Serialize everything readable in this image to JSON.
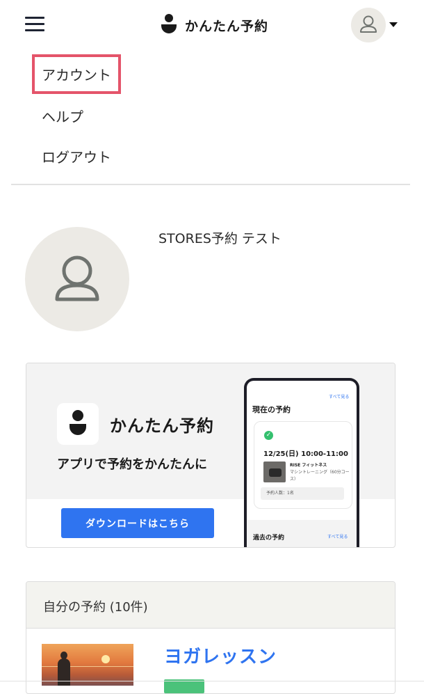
{
  "header": {
    "logo_text": "かんたん予約",
    "menu_icon": "hamburger-menu-icon",
    "user_icon": "user-icon",
    "caret_icon": "caret-down-icon"
  },
  "menu": {
    "items": [
      {
        "label": "アカウント"
      },
      {
        "label": "ヘルプ"
      },
      {
        "label": "ログアウト"
      }
    ],
    "highlight_color": "#e4546a"
  },
  "profile": {
    "name": "STORES予約 テスト"
  },
  "banner": {
    "app_name": "かんたん予約",
    "tagline": "アプリで予約をかんたんに",
    "download_label": "ダウンロードはこちら",
    "phone": {
      "see_all": "すべて見る",
      "current_title": "現在の予約",
      "date_time": "12/25(日) 10:00-11:00",
      "shop": "RISE フィットネス",
      "course": "マシントレーニング（60分コース）",
      "people": "予約人数：1名",
      "past_title": "過去の予約",
      "see_all_past": "すべて見る"
    }
  },
  "reservations": {
    "title": "自分の予約 (10件)",
    "items": [
      {
        "name": "ヨガレッスン"
      }
    ]
  },
  "colors": {
    "accent_blue": "#2f74f0",
    "success_green": "#4bc27a",
    "avatar_bg": "#eceae5"
  }
}
